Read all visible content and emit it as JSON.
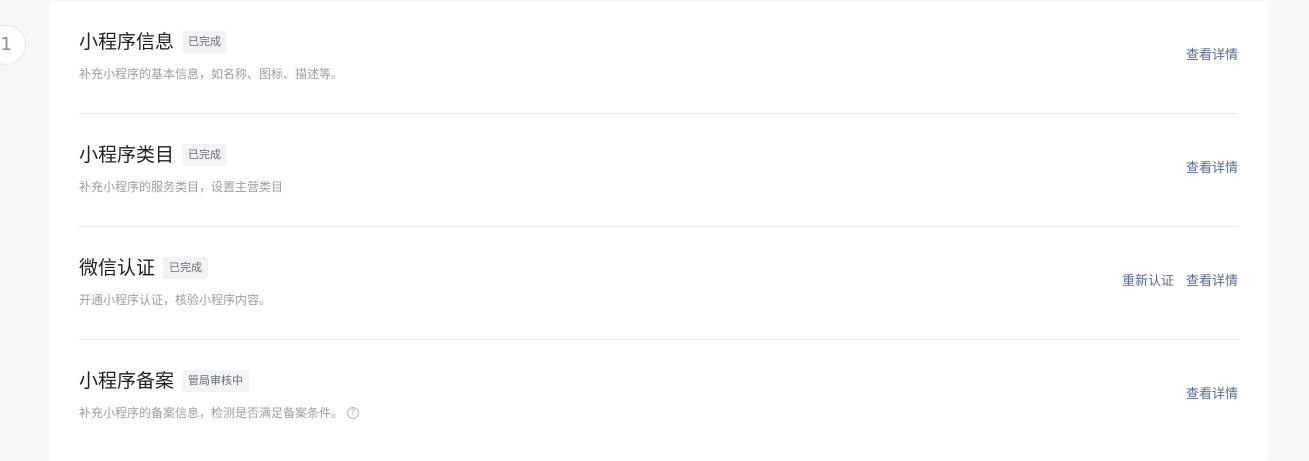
{
  "step": {
    "number": "1"
  },
  "rows": [
    {
      "title": "小程序信息",
      "status": "已完成",
      "description": "补充小程序的基本信息，如名称、图标、描述等。",
      "actions": [
        "查看详情"
      ]
    },
    {
      "title": "小程序类目",
      "status": "已完成",
      "description": "补充小程序的服务类目，设置主营类目",
      "actions": [
        "查看详情"
      ]
    },
    {
      "title": "微信认证",
      "status": "已完成",
      "description": "开通小程序认证，核验小程序内容。",
      "actions": [
        "重新认证",
        "查看详情"
      ]
    },
    {
      "title": "小程序备案",
      "status": "管局审核中",
      "description": "补充小程序的备案信息，检测是否满足备案条件。",
      "help_icon": "question-circle-icon",
      "actions": [
        "查看详情"
      ]
    }
  ]
}
